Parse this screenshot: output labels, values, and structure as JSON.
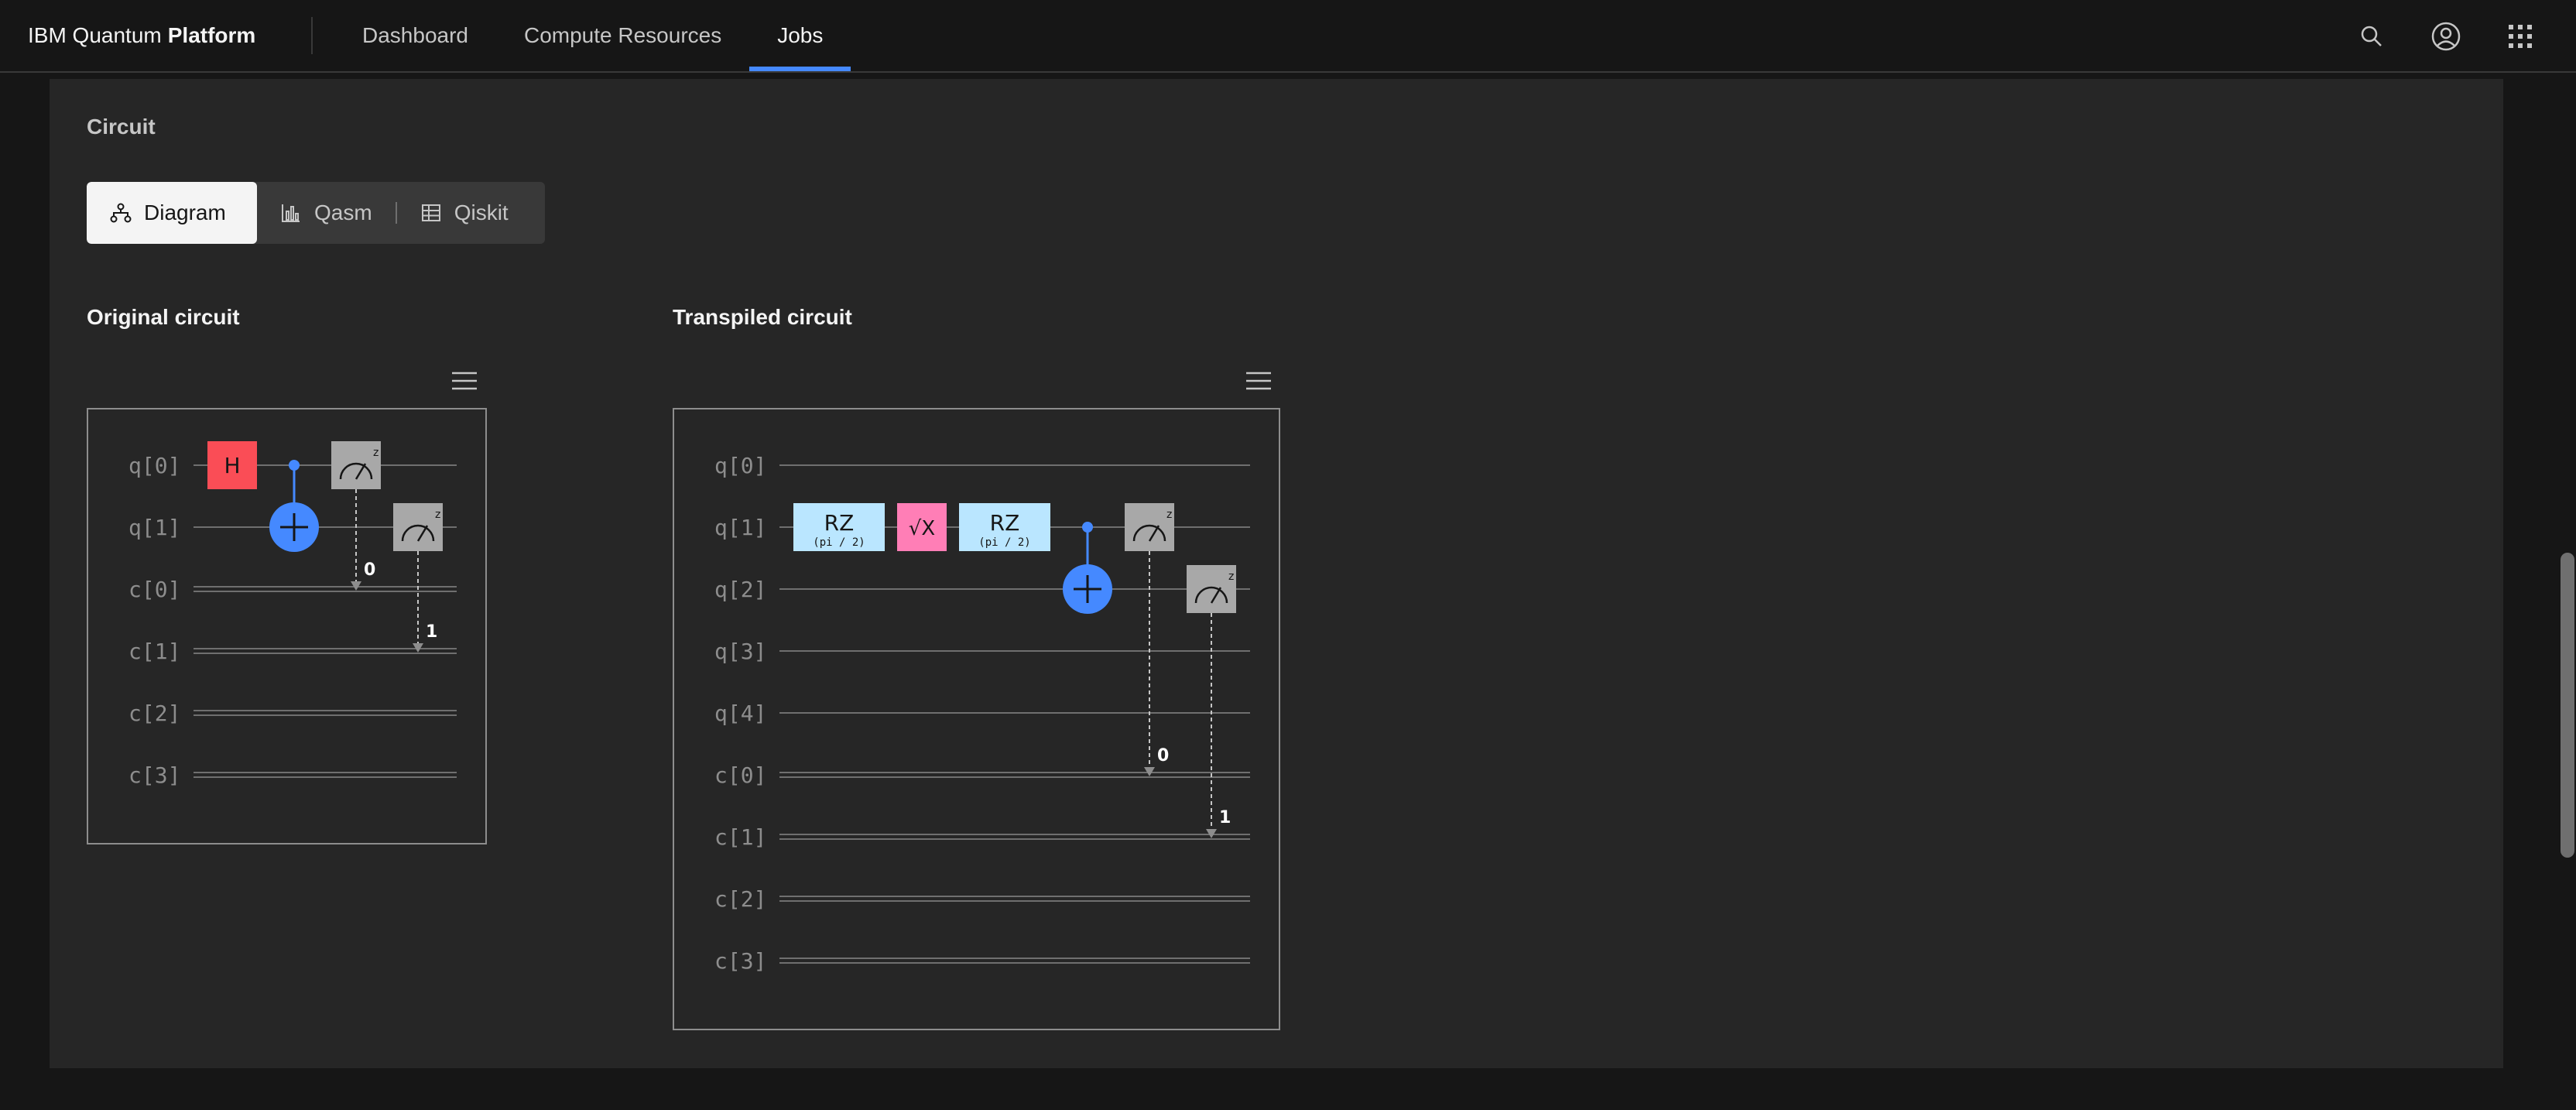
{
  "header": {
    "brand_prefix": "IBM Quantum",
    "brand_bold": "Platform",
    "nav": [
      {
        "label": "Dashboard",
        "active": false
      },
      {
        "label": "Compute Resources",
        "active": false
      },
      {
        "label": "Jobs",
        "active": true
      }
    ],
    "icons": [
      "search-icon",
      "user-avatar-icon",
      "app-switcher-icon"
    ]
  },
  "circuit": {
    "section_title": "Circuit",
    "tabs": [
      {
        "label": "Diagram",
        "icon": "flow-icon",
        "active": true
      },
      {
        "label": "Qasm",
        "icon": "chart-icon",
        "active": false
      },
      {
        "label": "Qiskit",
        "icon": "table-icon",
        "active": false
      }
    ],
    "original": {
      "title": "Original circuit",
      "wires": [
        "q[0]",
        "q[1]",
        "c[0]",
        "c[1]",
        "c[2]",
        "c[3]"
      ],
      "gates": [
        "H"
      ],
      "measure_label": "z",
      "bit_labels": [
        "0",
        "1"
      ]
    },
    "transpiled": {
      "title": "Transpiled circuit",
      "wires": [
        "q[0]",
        "q[1]",
        "q[2]",
        "q[3]",
        "q[4]",
        "c[0]",
        "c[1]",
        "c[2]",
        "c[3]"
      ],
      "gates": [
        {
          "name": "RZ",
          "param": "(pi / 2)"
        },
        {
          "name": "√X",
          "param": ""
        },
        {
          "name": "RZ",
          "param": "(pi / 2)"
        }
      ],
      "measure_label": "z",
      "bit_labels": [
        "0",
        "1"
      ]
    }
  },
  "colors": {
    "accent": "#4589ff",
    "h_gate": "#fa4d56",
    "rz_gate": "#bae6ff",
    "sx_gate": "#ff7eb6",
    "measure_gate": "#a8a8a8"
  }
}
